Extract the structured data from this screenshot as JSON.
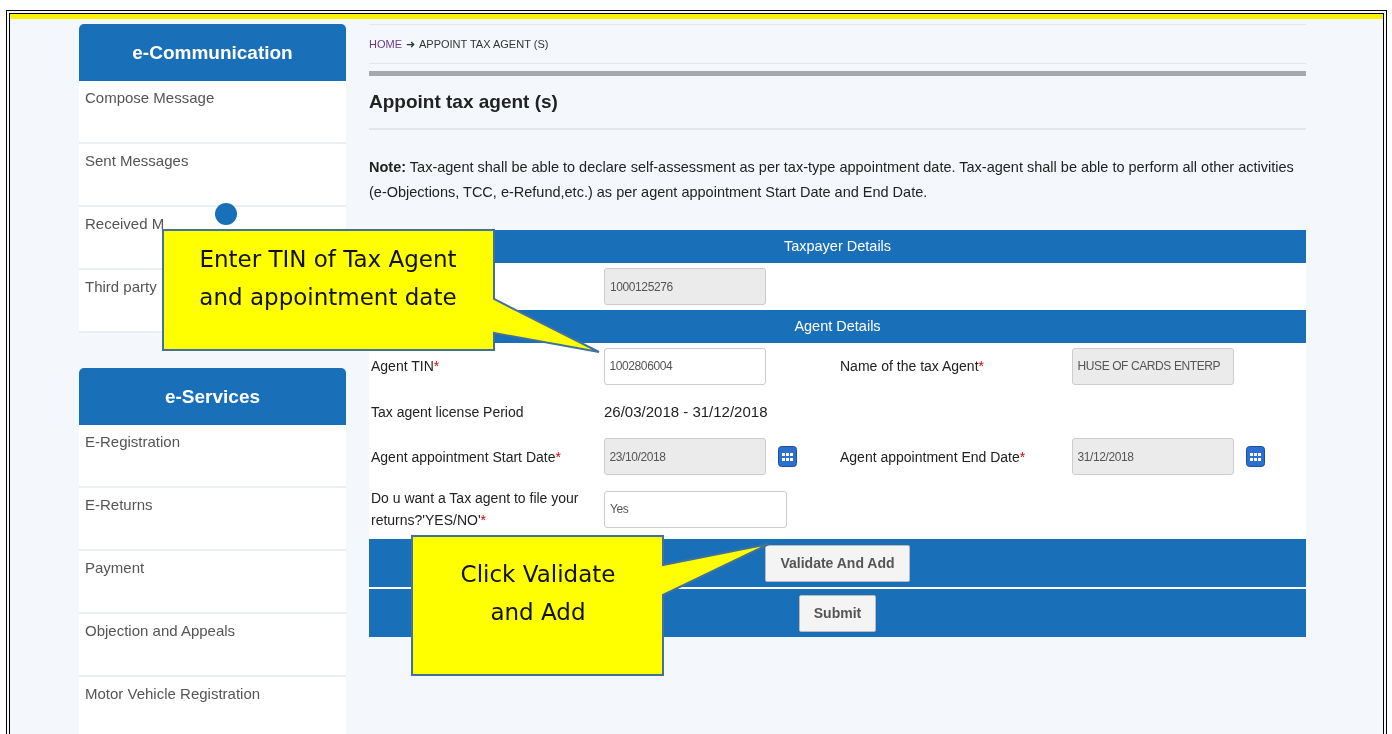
{
  "sidebar": [
    {
      "title": "e-Communication",
      "items": [
        "Compose Message",
        "Sent Messages",
        "Received M",
        "Third party"
      ]
    },
    {
      "title": "e-Services",
      "items": [
        "E-Registration",
        "E-Returns",
        "Payment",
        "Objection and Appeals",
        "Motor Vehicle Registration"
      ]
    }
  ],
  "breadcrumb": {
    "home": "HOME",
    "separator": "➜",
    "current": "APPOINT TAX AGENT (S)"
  },
  "page_title": "Appoint tax agent (s)",
  "note": "**Note:** Tax-agent shall be able to declare self-assessment as per tax-type appointment date. Tax-agent shall be able to perform all other activities (e-Objections, TCC, e-Refund,etc.) as per agent appointment Start Date and End Date.",
  "taxpayer": {
    "heading": "Taxpayer Details",
    "tin": {
      "value": "1000125276",
      "readonly": true
    }
  },
  "agent": {
    "heading": "Agent Details",
    "rows": [
      {
        "cells": [
          {
            "label": "Agent TIN",
            "mark": "*",
            "kind": "field",
            "value": "1002806004",
            "readonly": false
          },
          {
            "label": "Name of the tax Agent",
            "mark": "*",
            "kind": "field",
            "value": "HUSE OF CARDS ENTERP",
            "readonly": true
          }
        ]
      },
      {
        "cells": [
          {
            "label": "Tax agent license Period",
            "kind": "text",
            "value": "26/03/2018 - 31/12/2018"
          }
        ]
      },
      {
        "cells": [
          {
            "label": "Agent appointment Start Date",
            "mark": "*",
            "kind": "field",
            "value": "23/10/2018",
            "readonly": true,
            "calendar": true
          },
          {
            "label": "Agent appointment End Date",
            "mark": "*",
            "kind": "field",
            "value": "31/12/2018",
            "readonly": true,
            "calendar": true
          }
        ]
      },
      {
        "cells": [
          {
            "label": "Do u want a Tax agent to file your returns?'YES/NO'",
            "mark": "*",
            "kind": "wide-field",
            "value": "Yes",
            "readonly": false
          }
        ]
      }
    ]
  },
  "buttons": {
    "validate": "Validate And Add",
    "submit": "Submit"
  },
  "callouts": [
    {
      "text": "Enter TIN of Tax Agent and appointment date"
    },
    {
      "text": "Click Validate and Add"
    }
  ]
}
